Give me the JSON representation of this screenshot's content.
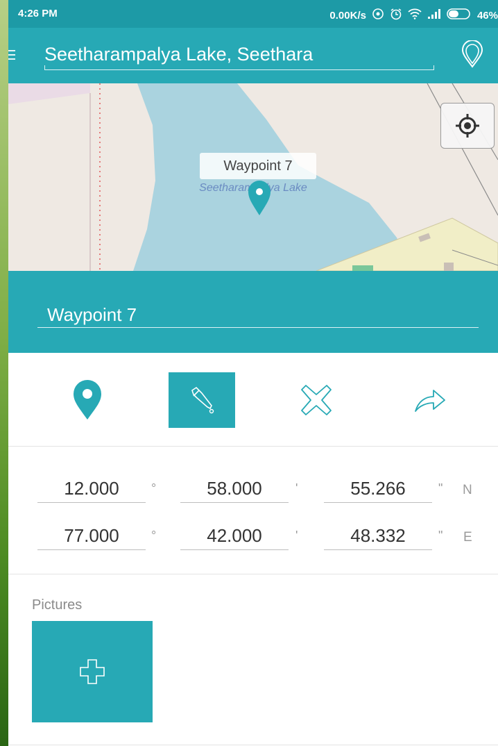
{
  "status_bar": {
    "time": "4:26 PM",
    "network_speed": "0.00K/s",
    "battery": "46%",
    "icons": [
      "hotspot-icon",
      "alarm-icon",
      "wifi-icon",
      "signal-icon",
      "battery-icon"
    ]
  },
  "top_bar": {
    "location": "Seetharampalya Lake, Seethara",
    "icons": [
      "menu-icon",
      "pin-outline-icon"
    ]
  },
  "map": {
    "marker_label": "Waypoint 7",
    "lake_label": "Seetharampalya Lake",
    "icons": [
      "map-marker-icon",
      "locate-icon"
    ]
  },
  "waypoint": {
    "name": "Waypoint 7"
  },
  "actions": {
    "icons": [
      "pin-icon",
      "color-dropper-icon",
      "delete-icon",
      "share-icon"
    ],
    "selected": "color-dropper-icon"
  },
  "coordinates": {
    "lat": {
      "deg": "12.000",
      "min": "58.000",
      "sec": "55.266",
      "dir": "N"
    },
    "lon": {
      "deg": "77.000",
      "min": "42.000",
      "sec": "48.332",
      "dir": "E"
    },
    "symbols": {
      "deg": "°",
      "min": "'",
      "sec": "\""
    }
  },
  "pictures": {
    "label": "Pictures",
    "add_icon": "plus-icon"
  },
  "colors": {
    "accent": "#27a9b5",
    "status_bar": "#1d9aa6",
    "lake": "#aad3df",
    "map_land": "#efe9e3"
  }
}
